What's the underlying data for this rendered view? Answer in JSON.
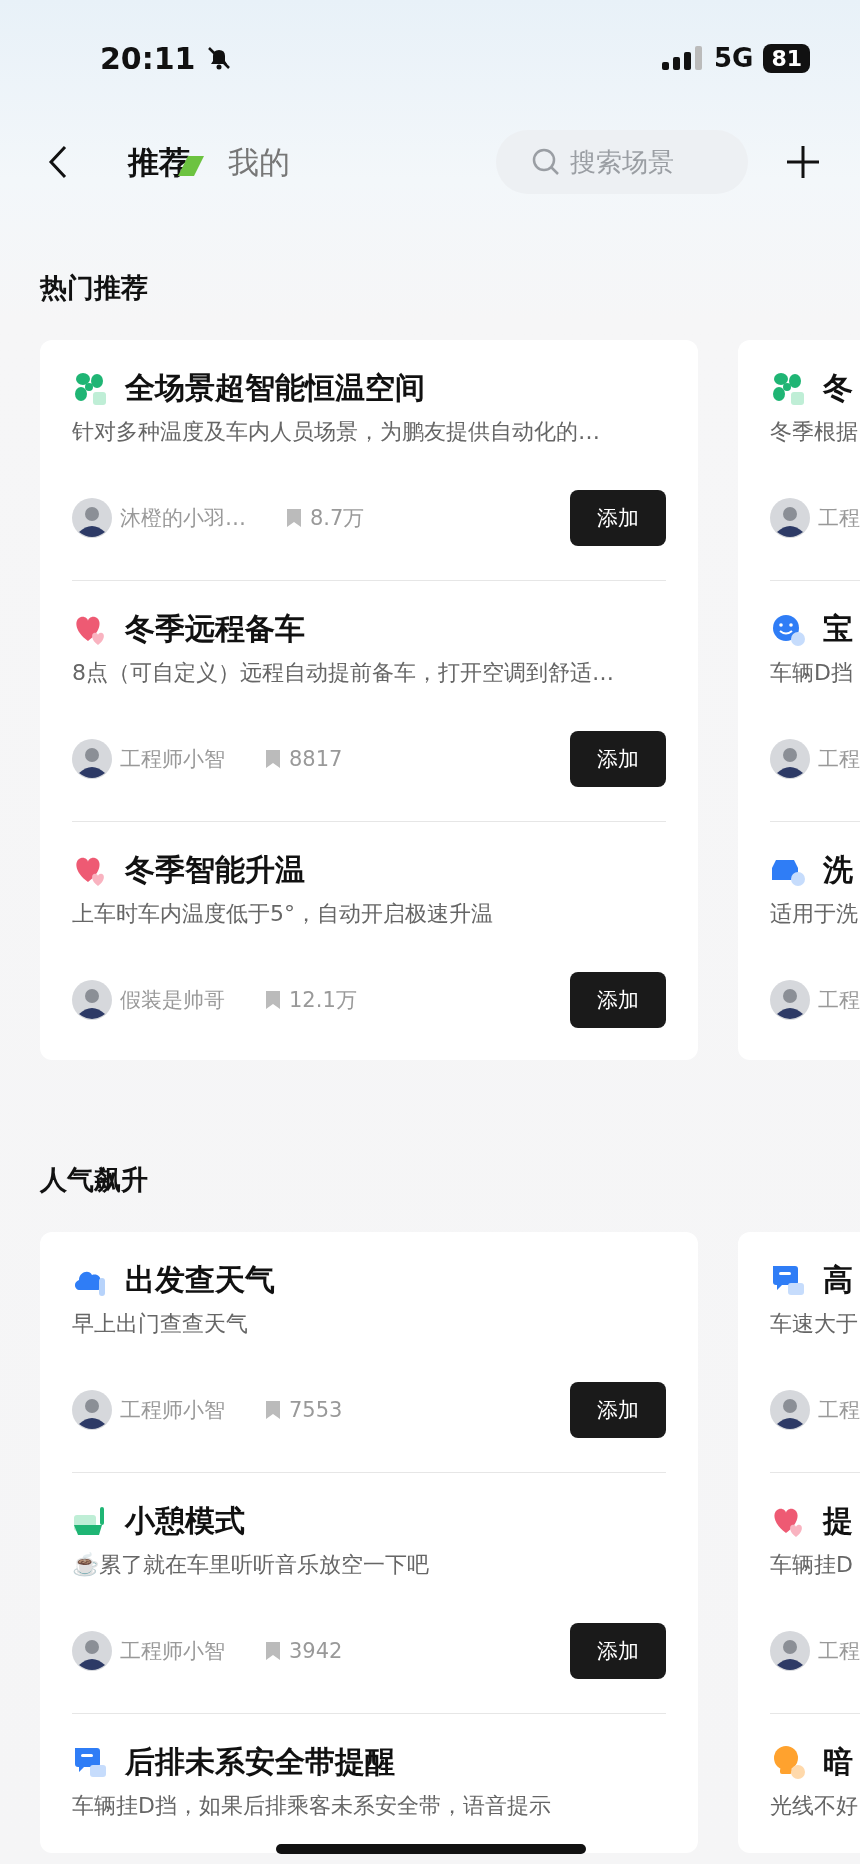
{
  "status_bar": {
    "time": "20:11",
    "silent": true,
    "network": "5G",
    "battery": "81"
  },
  "nav": {
    "tabs": [
      {
        "label": "推荐",
        "selected": true
      },
      {
        "label": "我的",
        "selected": false
      }
    ],
    "search": {
      "placeholder": "搜索场景"
    }
  },
  "sections": [
    {
      "title": "热门推荐",
      "cards": [
        {
          "items": [
            {
              "kind": "fan",
              "title": "全场景超智能恒温空间",
              "description": "针对多种温度及车内人员场景，为鹏友提供自动化的…",
              "author": "沐橙的小羽…",
              "saves": "8.7万",
              "button": "添加"
            },
            {
              "kind": "heart",
              "title": "冬季远程备车",
              "description": "8点（可自定义）远程自动提前备车，打开空调到舒适…",
              "author": "工程师小智",
              "saves": "8817",
              "button": "添加"
            },
            {
              "kind": "heart",
              "title": "冬季智能升温",
              "description": "上车时车内温度低于5°，自动开启极速升温",
              "author": "假装是帅哥",
              "saves": "12.1万",
              "button": "添加"
            }
          ]
        },
        {
          "items": [
            {
              "kind": "fan",
              "title": "冬",
              "description": "冬季根据",
              "author": "工程"
            },
            {
              "kind": "smiley",
              "title": "宝",
              "description": "车辆D挡",
              "author": "工程"
            },
            {
              "kind": "car",
              "title": "洗",
              "description": "适用于洗",
              "author": "工程"
            }
          ]
        }
      ]
    },
    {
      "title": "人气飙升",
      "cards": [
        {
          "items": [
            {
              "kind": "cloud",
              "title": "出发查天气",
              "description": "早上出门查查天气",
              "author": "工程师小智",
              "saves": "7553",
              "button": "添加"
            },
            {
              "kind": "seat",
              "title": "小憩模式",
              "description": "☕️累了就在车里听听音乐放空一下吧",
              "author": "工程师小智",
              "saves": "3942",
              "button": "添加"
            },
            {
              "kind": "chat",
              "title": "后排未系安全带提醒",
              "description": "车辆挂D挡，如果后排乘客未系安全带，语音提示"
            }
          ]
        },
        {
          "items": [
            {
              "kind": "chat",
              "title": "高",
              "description": "车速大于",
              "author": "工程"
            },
            {
              "kind": "heart",
              "title": "提",
              "description": "车辆挂D",
              "author": "工程"
            },
            {
              "kind": "bulb",
              "title": "暗",
              "description": "光线不好"
            }
          ]
        }
      ]
    }
  ]
}
